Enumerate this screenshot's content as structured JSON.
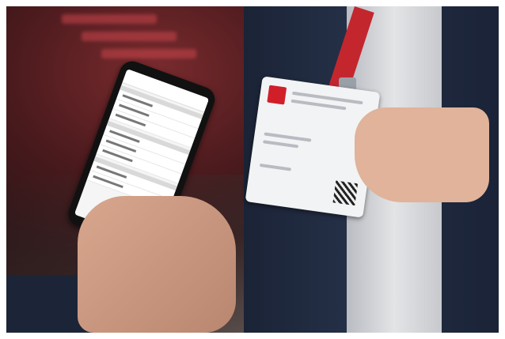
{
  "photo": {
    "description_icons": [
      "smartphone-icon",
      "badge-icon",
      "qr-code-icon",
      "lanyard-icon"
    ]
  }
}
